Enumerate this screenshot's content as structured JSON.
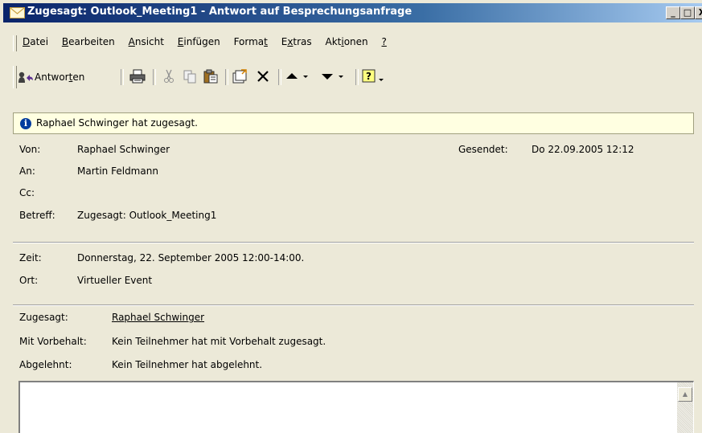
{
  "window": {
    "title": "Zugesagt: Outlook_Meeting1 - Antwort auf Besprechungsanfrage",
    "controls": [
      "_",
      "□",
      "X"
    ]
  },
  "menu": {
    "items": [
      "Datei",
      "Bearbeiten",
      "Ansicht",
      "Einfügen",
      "Format",
      "Extras",
      "Aktionen",
      "?"
    ]
  },
  "toolbar": {
    "reply_label": "Antworten",
    "icons": [
      "reply-icon",
      "print-icon",
      "cut-icon",
      "copy-icon",
      "paste-icon",
      "move-to-folder-icon",
      "delete-icon",
      "previous-item-icon",
      "next-item-icon",
      "help-icon"
    ]
  },
  "info": {
    "text": "Raphael Schwinger hat zugesagt."
  },
  "header": {
    "from_label": "Von:",
    "from_value": "Raphael Schwinger",
    "sent_label": "Gesendet:",
    "sent_value": "Do 22.09.2005 12:12",
    "to_label": "An:",
    "to_value": "Martin Feldmann",
    "cc_label": "Cc:",
    "cc_value": "",
    "subject_label": "Betreff:",
    "subject_value": "Zugesagt: Outlook_Meeting1"
  },
  "meeting": {
    "time_label": "Zeit:",
    "time_value": "Donnerstag, 22. September 2005 12:00-14:00.",
    "location_label": "Ort:",
    "location_value": "Virtueller Event"
  },
  "responses": {
    "accepted_label": "Zugesagt:",
    "accepted_value": "Raphael Schwinger",
    "tentative_label": "Mit Vorbehalt:",
    "tentative_value": "Kein Teilnehmer hat mit Vorbehalt zugesagt.",
    "declined_label": "Abgelehnt:",
    "declined_value": "Kein Teilnehmer hat abgelehnt."
  }
}
